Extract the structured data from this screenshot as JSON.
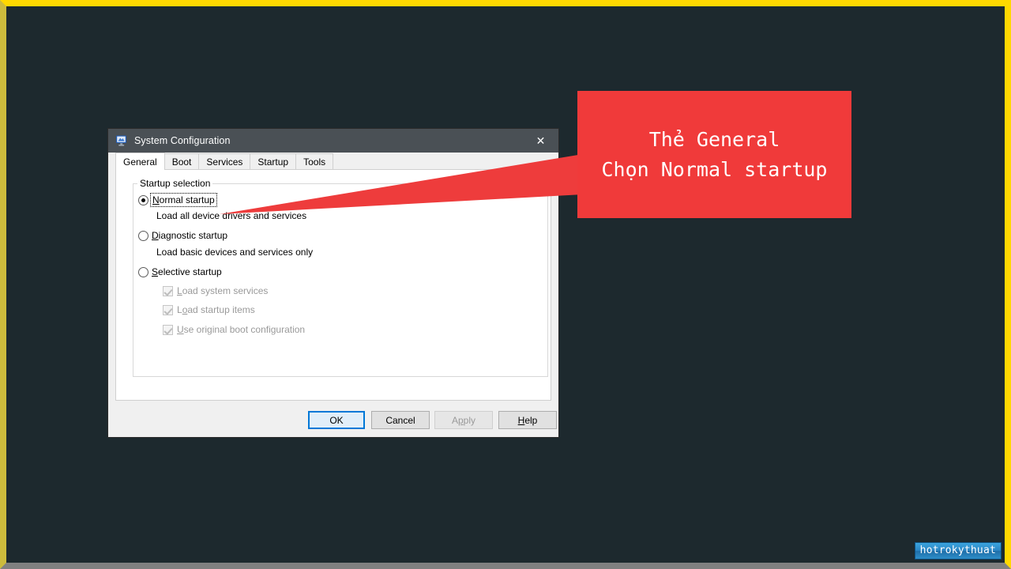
{
  "window": {
    "title": "System Configuration",
    "icon": "system-configuration-icon",
    "close_label": "✕"
  },
  "tabs": [
    {
      "label": "General",
      "active": true
    },
    {
      "label": "Boot",
      "active": false
    },
    {
      "label": "Services",
      "active": false
    },
    {
      "label": "Startup",
      "active": false
    },
    {
      "label": "Tools",
      "active": false
    }
  ],
  "group": {
    "title": "Startup selection"
  },
  "options": [
    {
      "label_before": "",
      "accel": "N",
      "label_after": "ormal startup",
      "selected": true,
      "focused": true,
      "description": "Load all device drivers and services"
    },
    {
      "label_before": "",
      "accel": "D",
      "label_after": "iagnostic startup",
      "selected": false,
      "focused": false,
      "description": "Load basic devices and services only"
    },
    {
      "label_before": "",
      "accel": "S",
      "label_after": "elective startup",
      "selected": false,
      "focused": false,
      "description": ""
    }
  ],
  "checkboxes": [
    {
      "label_before": "",
      "accel": "L",
      "label_after": "oad system services",
      "checked": true,
      "disabled": true
    },
    {
      "label_before": "L",
      "accel": "o",
      "label_after": "ad startup items",
      "checked": true,
      "disabled": true
    },
    {
      "label_before": "",
      "accel": "U",
      "label_after": "se original boot configuration",
      "checked": true,
      "disabled": true
    }
  ],
  "buttons": [
    {
      "label": "OK",
      "state": "default"
    },
    {
      "label": "Cancel",
      "state": "normal"
    },
    {
      "label_before": "A",
      "accel": "p",
      "label_after": "ply",
      "label": "Apply",
      "state": "disabled"
    },
    {
      "label_before": "",
      "accel": "H",
      "label_after": "elp",
      "label": "Help",
      "state": "normal"
    }
  ],
  "callout": {
    "line1": "Thẻ General",
    "line2": "Chọn Normal startup",
    "color": "#f03a3a"
  },
  "watermark": {
    "text": "hotrokythuat"
  },
  "theme": {
    "background": "#1d292e",
    "border_top": "#ffd800",
    "border_bottom": "#808080",
    "titlebar": "#4a5055",
    "accent_blue": "#0078d7"
  }
}
